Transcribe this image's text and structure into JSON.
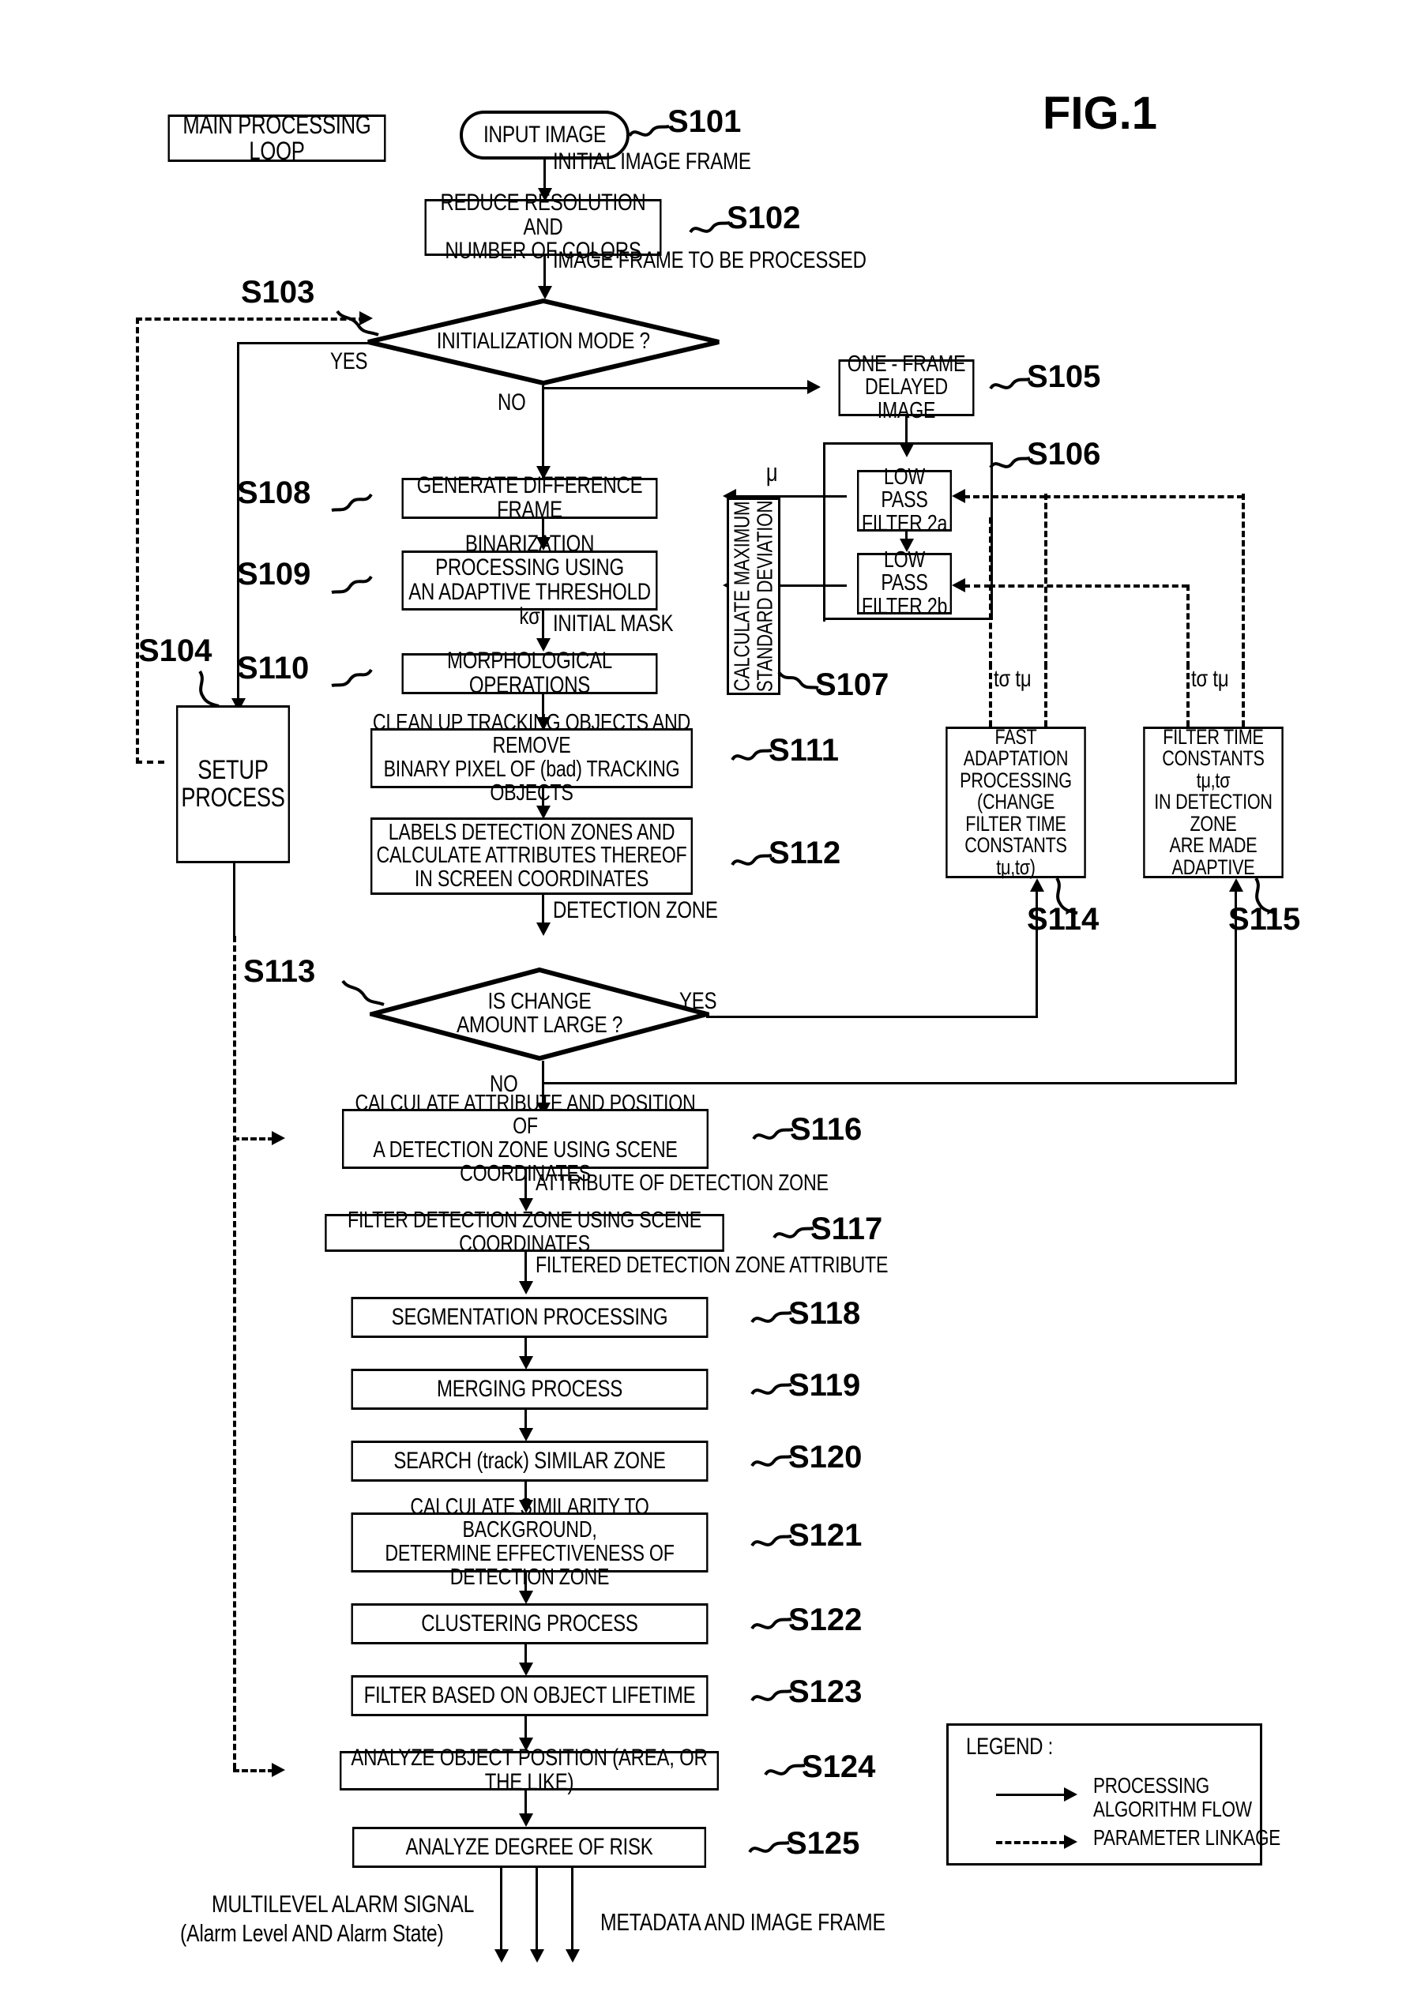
{
  "figure": {
    "title": "FIG.1"
  },
  "legend": {
    "title": "LEGEND :",
    "items": [
      {
        "style": "solid",
        "label_line1": "PROCESSING",
        "label_line2": "ALGORITHM FLOW"
      },
      {
        "style": "dashed",
        "label_line1": "PARAMETER LINKAGE",
        "label_line2": ""
      }
    ]
  },
  "nodes": {
    "main_loop": {
      "label": "MAIN PROCESSING LOOP"
    },
    "s101": {
      "step": "S101",
      "label": "INPUT IMAGE"
    },
    "s102": {
      "step": "S102",
      "line1": "REDUCE RESOLUTION AND",
      "line2": "NUMBER OF COLORS"
    },
    "s103": {
      "step": "S103",
      "label": "INITIALIZATION MODE ?"
    },
    "s104": {
      "step": "S104",
      "line1": "SETUP",
      "line2": "PROCESS"
    },
    "s105": {
      "step": "S105",
      "line1": "ONE - FRAME",
      "line2": "DELAYED IMAGE"
    },
    "s106": {
      "step": "S106",
      "lpf_a_l1": "LOW PASS",
      "lpf_a_l2": "FILTER 2a",
      "lpf_b_l1": "LOW PASS",
      "lpf_b_l2": "FILTER 2b"
    },
    "s107": {
      "step": "S107",
      "line1": "CALCULATE MAXIMUM",
      "line2": "STANDARD DEVIATION"
    },
    "s108": {
      "step": "S108",
      "label": "GENERATE DIFFERENCE FRAME"
    },
    "s109": {
      "step": "S109",
      "line1": "BINARIZATION PROCESSING USING",
      "line2": "AN ADAPTIVE THRESHOLD kσ"
    },
    "s110": {
      "step": "S110",
      "label": "MORPHOLOGICAL OPERATIONS"
    },
    "s111": {
      "step": "S111",
      "line1": "CLEAN UP TRACKING OBJECTS AND REMOVE",
      "line2": "BINARY PIXEL OF (bad) TRACKING OBJECTS"
    },
    "s112": {
      "step": "S112",
      "line1": "LABELS DETECTION ZONES AND",
      "line2": "CALCULATE ATTRIBUTES THEREOF",
      "line3": "IN SCREEN COORDINATES"
    },
    "s113": {
      "step": "S113",
      "line1": "IS CHANGE",
      "line2": "AMOUNT LARGE ?"
    },
    "s114": {
      "step": "S114",
      "line1": "FAST ADAPTATION",
      "line2": "PROCESSING",
      "line3": "(CHANGE FILTER TIME",
      "line4": "CONSTANTS  tμ,tσ)"
    },
    "s115": {
      "step": "S115",
      "line1": "FILTER TIME",
      "line2": "CONSTANTS tμ,tσ",
      "line3": "IN DETECTION ZONE",
      "line4": "ARE MADE ADAPTIVE"
    },
    "s116": {
      "step": "S116",
      "line1": "CALCULATE ATTRIBUTE AND POSITION OF",
      "line2": "A DETECTION ZONE USING SCENE COORDINATES"
    },
    "s117": {
      "step": "S117",
      "label": "FILTER DETECTION ZONE USING SCENE COORDINATES"
    },
    "s118": {
      "step": "S118",
      "label": "SEGMENTATION PROCESSING"
    },
    "s119": {
      "step": "S119",
      "label": "MERGING PROCESS"
    },
    "s120": {
      "step": "S120",
      "label": "SEARCH (track) SIMILAR ZONE"
    },
    "s121": {
      "step": "S121",
      "line1": "CALCULATE SIMILARITY TO BACKGROUND,",
      "line2": "DETERMINE EFFECTIVENESS OF DETECTION ZONE"
    },
    "s122": {
      "step": "S122",
      "label": "CLUSTERING PROCESS"
    },
    "s123": {
      "step": "S123",
      "label": "FILTER BASED ON OBJECT LIFETIME"
    },
    "s124": {
      "step": "S124",
      "label": "ANALYZE OBJECT POSITION (AREA, OR THE LIKE)"
    },
    "s125": {
      "step": "S125",
      "label": "ANALYZE DEGREE OF RISK"
    }
  },
  "edge_labels": {
    "initial_image_frame": "INITIAL IMAGE FRAME",
    "image_frame_to_be_processed": "IMAGE FRAME TO BE PROCESSED",
    "yes_top": "YES",
    "no_top": "NO",
    "mu": "μ",
    "initial_mask": "INITIAL MASK",
    "detection_zone": "DETECTION ZONE",
    "yes_mid": "YES",
    "no_mid": "NO",
    "attribute_of_detection_zone": "ATTRIBUTE OF DETECTION ZONE",
    "filtered_detection_zone_attribute": "FILTERED DETECTION ZONE ATTRIBUTE",
    "tsig_tmu_left": "tσ  tμ",
    "tsig_tmu_right": "tσ  tμ"
  },
  "outputs": {
    "alarm_line1": "MULTILEVEL ALARM SIGNAL",
    "alarm_line2": "(Alarm Level AND Alarm State)",
    "metadata": "METADATA AND IMAGE FRAME"
  },
  "colors": {
    "ink": "#000000",
    "paper": "#ffffff"
  }
}
